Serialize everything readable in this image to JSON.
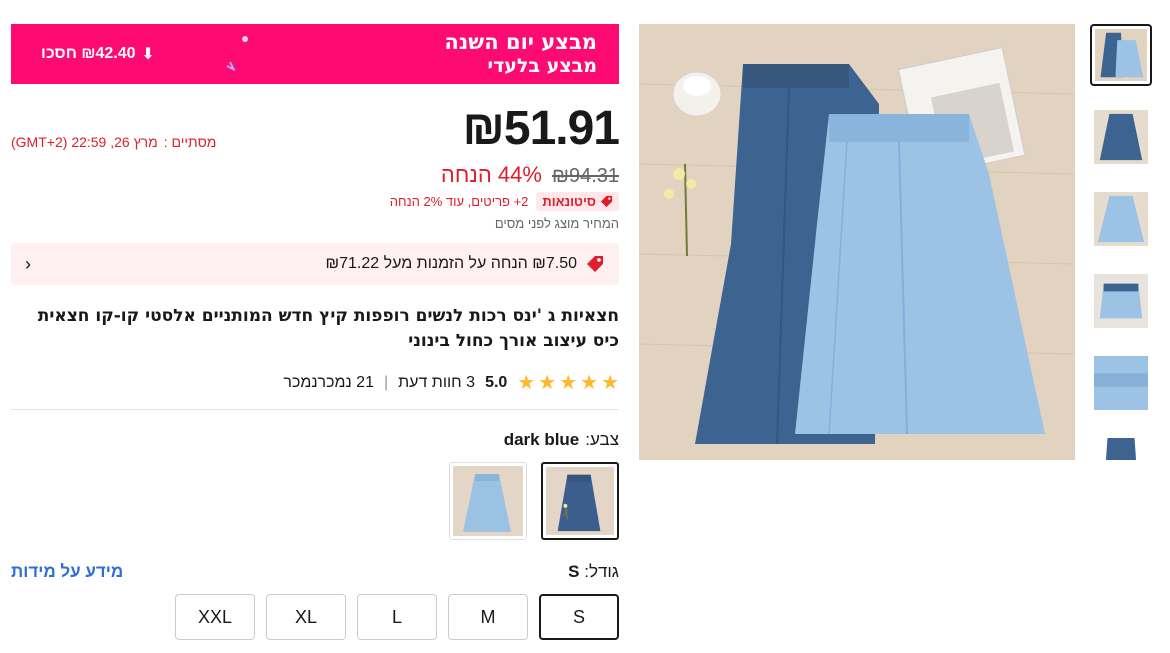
{
  "promo": {
    "title": "מבצע יום השנה",
    "subtitle": "מבצע בלעדי",
    "save_text": "₪42.40 חסכו",
    "background": "#fd0a72"
  },
  "price": {
    "current": "₪51.91",
    "original": "₪94.31",
    "discount": "44% הנחה",
    "countdown_label": "מסתיים :",
    "countdown_value": "מרץ 26, 22:59 (GMT+2)"
  },
  "bulk": {
    "badge": "סיטונאות",
    "text": "2+ פריטים, עוד 2% הנחה"
  },
  "tax_note": "המחיר מוצג לפני מסים",
  "coupon": {
    "text": "₪7.50 הנחה על הזמנות מעל ₪71.22"
  },
  "product": {
    "title": "חצאיות ג 'ינס רכות לנשים רופפות קיץ חדש המותניים אלסטי קו-קו חצאית כיס עיצוב אורך כחול בינוני"
  },
  "rating": {
    "value": "5.0",
    "reviews": "3 חוות דעת",
    "sold": "21 נמכרנמכר",
    "stars": 5
  },
  "color": {
    "label": "צבע:",
    "selected": "dark blue",
    "options": [
      "dark blue",
      "light blue"
    ]
  },
  "size": {
    "label": "גודל:",
    "selected": "S",
    "guide": "מידע על מידות",
    "options": [
      "S",
      "M",
      "L",
      "XL",
      "XXL"
    ]
  },
  "colors": {
    "accent": "#fd0a72",
    "sale_red": "#e01d2a",
    "star": "#fdb82c",
    "link_blue": "#2e6fd6"
  }
}
